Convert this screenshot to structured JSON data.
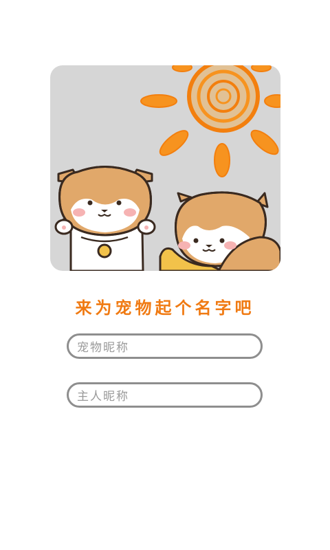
{
  "title": "来为宠物起个名字吧",
  "fields": [
    {
      "label": "宠物昵称",
      "value": "",
      "placeholder": ""
    },
    {
      "label": "主人昵称",
      "value": "",
      "placeholder": ""
    }
  ],
  "colors": {
    "accent": "#f07a12",
    "illustration_bg": "#d6d6d6",
    "field_border": "#8e8e8e"
  }
}
